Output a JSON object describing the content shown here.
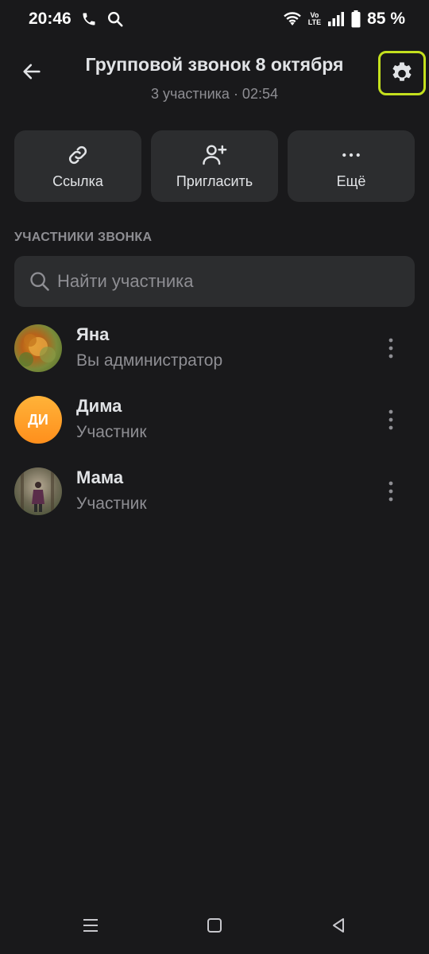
{
  "status_bar": {
    "time": "20:46",
    "battery": "85 %",
    "volte_top": "Vo",
    "volte_bottom": "LTE",
    "icons": [
      "phone-icon",
      "search-icon",
      "wifi-icon",
      "signal-icon",
      "battery-icon"
    ]
  },
  "header": {
    "title": "Групповой звонок 8 октября",
    "subtitle": "3 участника · 02:54",
    "settings_highlight_color": "#c4e01e"
  },
  "actions": [
    {
      "label": "Ссылка",
      "icon": "link-icon"
    },
    {
      "label": "Пригласить",
      "icon": "add-user-icon"
    },
    {
      "label": "Ещё",
      "icon": "more-horizontal-icon"
    }
  ],
  "section": {
    "title": "УЧАСТНИКИ ЗВОНКА"
  },
  "search": {
    "placeholder": "Найти участника",
    "value": ""
  },
  "participants": [
    {
      "name": "Яна",
      "role": "Вы администратор",
      "avatar": "photo"
    },
    {
      "name": "Дима",
      "role": "Участник",
      "avatar": "initials",
      "initials": "ДИ",
      "avatar_color": "#ff9f1c"
    },
    {
      "name": "Мама",
      "role": "Участник",
      "avatar": "photo"
    }
  ],
  "nav": [
    "menu-icon",
    "home-icon",
    "back-icon"
  ]
}
